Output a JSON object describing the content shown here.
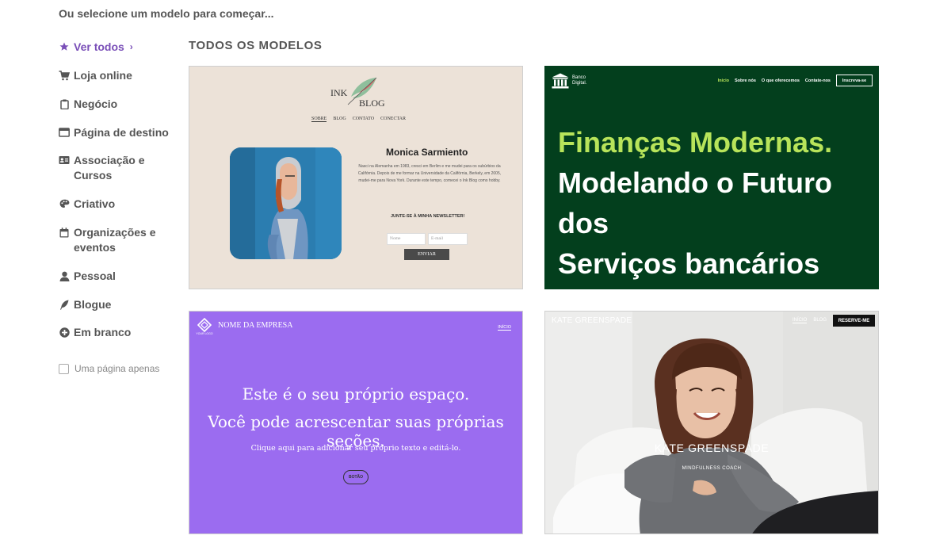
{
  "page": {
    "heading": "Ou selecione um modelo para começar..."
  },
  "sidebar": {
    "items": [
      {
        "label": "Ver todos",
        "icon": "star-icon"
      },
      {
        "label": "Loja online",
        "icon": "cart-icon"
      },
      {
        "label": "Negócio",
        "icon": "clipboard-icon"
      },
      {
        "label": "Página de destino",
        "icon": "browser-window-icon"
      },
      {
        "label": "Associação e Cursos",
        "icon": "id-card-icon"
      },
      {
        "label": "Criativo",
        "icon": "palette-icon"
      },
      {
        "label": "Organizações e eventos",
        "icon": "calendar-icon"
      },
      {
        "label": "Pessoal",
        "icon": "person-icon"
      },
      {
        "label": "Blogue",
        "icon": "quill-icon"
      },
      {
        "label": "Em branco",
        "icon": "plus-circle-icon"
      }
    ],
    "single_page": "Uma página apenas",
    "chevron": "›"
  },
  "main": {
    "title": "TODOS OS MODELOS"
  },
  "templates": {
    "ink": {
      "logo_1": "INK",
      "logo_2": "BLOG",
      "nav": [
        "SOBRE",
        "BLOG",
        "CONTATO",
        "CONECTAR"
      ],
      "name": "Monica Sarmiento",
      "bio": "Nasci na Alemanha em 1983, cresci em Berlim e me mudei para os subúrbios da Califórnia. Depois de me formar na Universidade da Califórnia, Berkely, em 2005, mudei-me para Nova York. Durante este tempo, comecei o Ink Blog como hobby.",
      "newsletter": "JUNTE-SE À MINHA NEWSLETTER!",
      "name_placeholder": "Nome",
      "email_placeholder": "E-mail",
      "submit": "ENVIAR"
    },
    "bank": {
      "logo_1": "Banco",
      "logo_2": "Digital.",
      "nav": [
        "Início",
        "Sobre nós",
        "O que oferecemos",
        "Contate-nos"
      ],
      "cta": "Inscreva-se",
      "headline_1": "Finanças Modernas.",
      "headline_2": "Modelando o Futuro",
      "headline_3": "dos",
      "headline_4": "Serviços bancários",
      "accent": "#b8e45a"
    },
    "purple": {
      "logo_small": "YOUR LOGO",
      "company": "NOME DA EMPRESA",
      "nav": "INÍCIO",
      "headline_1": "Este é o seu próprio espaço.",
      "headline_2": "Você pode acrescentar suas próprias seções.",
      "sub": "Clique aqui para adicionar seu próprio texto e editá-lo.",
      "button": "BOTÃO",
      "bg": "#9b6cf0"
    },
    "kate": {
      "name_top": "KATE GREENSPADE",
      "nav": [
        "INÍCIO",
        "BLOG"
      ],
      "cta": "RESERVE-ME",
      "name": "KATE GREENSPADE",
      "role": "MINDFULNESS COACH"
    }
  }
}
